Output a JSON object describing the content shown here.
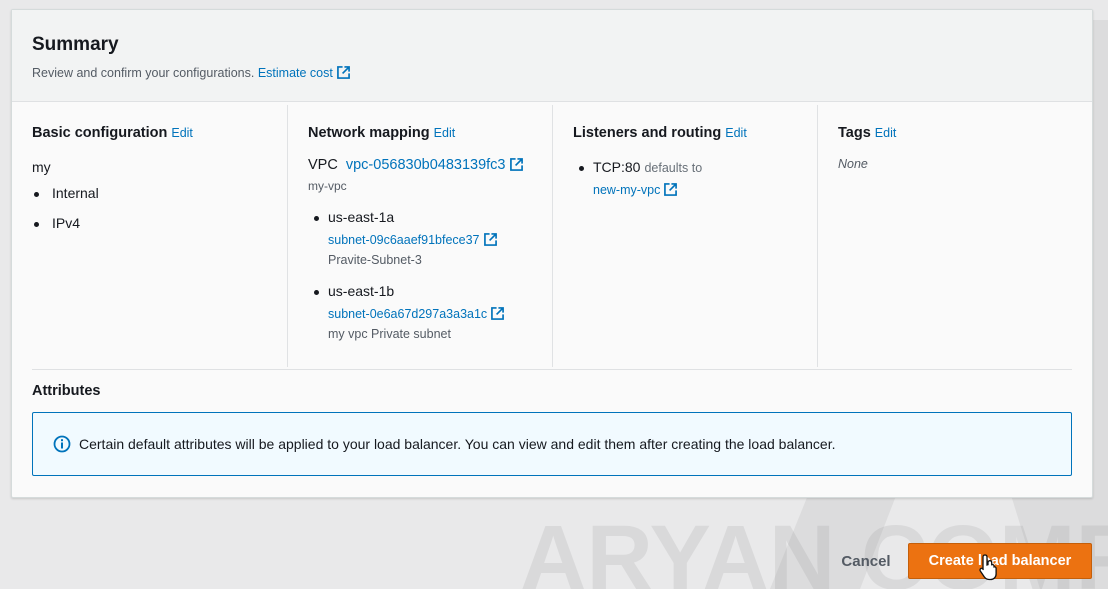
{
  "summary": {
    "title": "Summary",
    "description": "Review and confirm your configurations.",
    "estimate_link": "Estimate cost"
  },
  "basic": {
    "title": "Basic configuration",
    "edit": "Edit",
    "name": "my",
    "items": [
      "Internal",
      "IPv4"
    ]
  },
  "network": {
    "title": "Network mapping",
    "edit": "Edit",
    "vpc_label": "VPC",
    "vpc_id": "vpc-056830b0483139fc3",
    "vpc_name": "my-vpc",
    "zones": [
      {
        "az": "us-east-1a",
        "subnet": "subnet-09c6aaef91bfece37",
        "subnet_name": "Pravite-Subnet-3"
      },
      {
        "az": "us-east-1b",
        "subnet": "subnet-0e6a67d297a3a3a1c",
        "subnet_name": "my vpc Private subnet"
      }
    ]
  },
  "listeners": {
    "title": "Listeners and routing",
    "edit": "Edit",
    "protocol": "TCP:80",
    "defaults_to": "defaults to",
    "target": "new-my-vpc"
  },
  "tags": {
    "title": "Tags",
    "edit": "Edit",
    "value": "None"
  },
  "attributes": {
    "title": "Attributes",
    "alert": "Certain default attributes will be applied to your load balancer. You can view and edit them after creating the load balancer."
  },
  "footer": {
    "cancel": "Cancel",
    "create": "Create load balancer"
  },
  "watermark_text": "ARYAN COMP",
  "colors": {
    "link": "#0073bb",
    "primary": "#ec7211",
    "alert_border": "#0073bb"
  },
  "icons": [
    "external-link-icon",
    "info-icon",
    "hand-cursor-icon"
  ]
}
